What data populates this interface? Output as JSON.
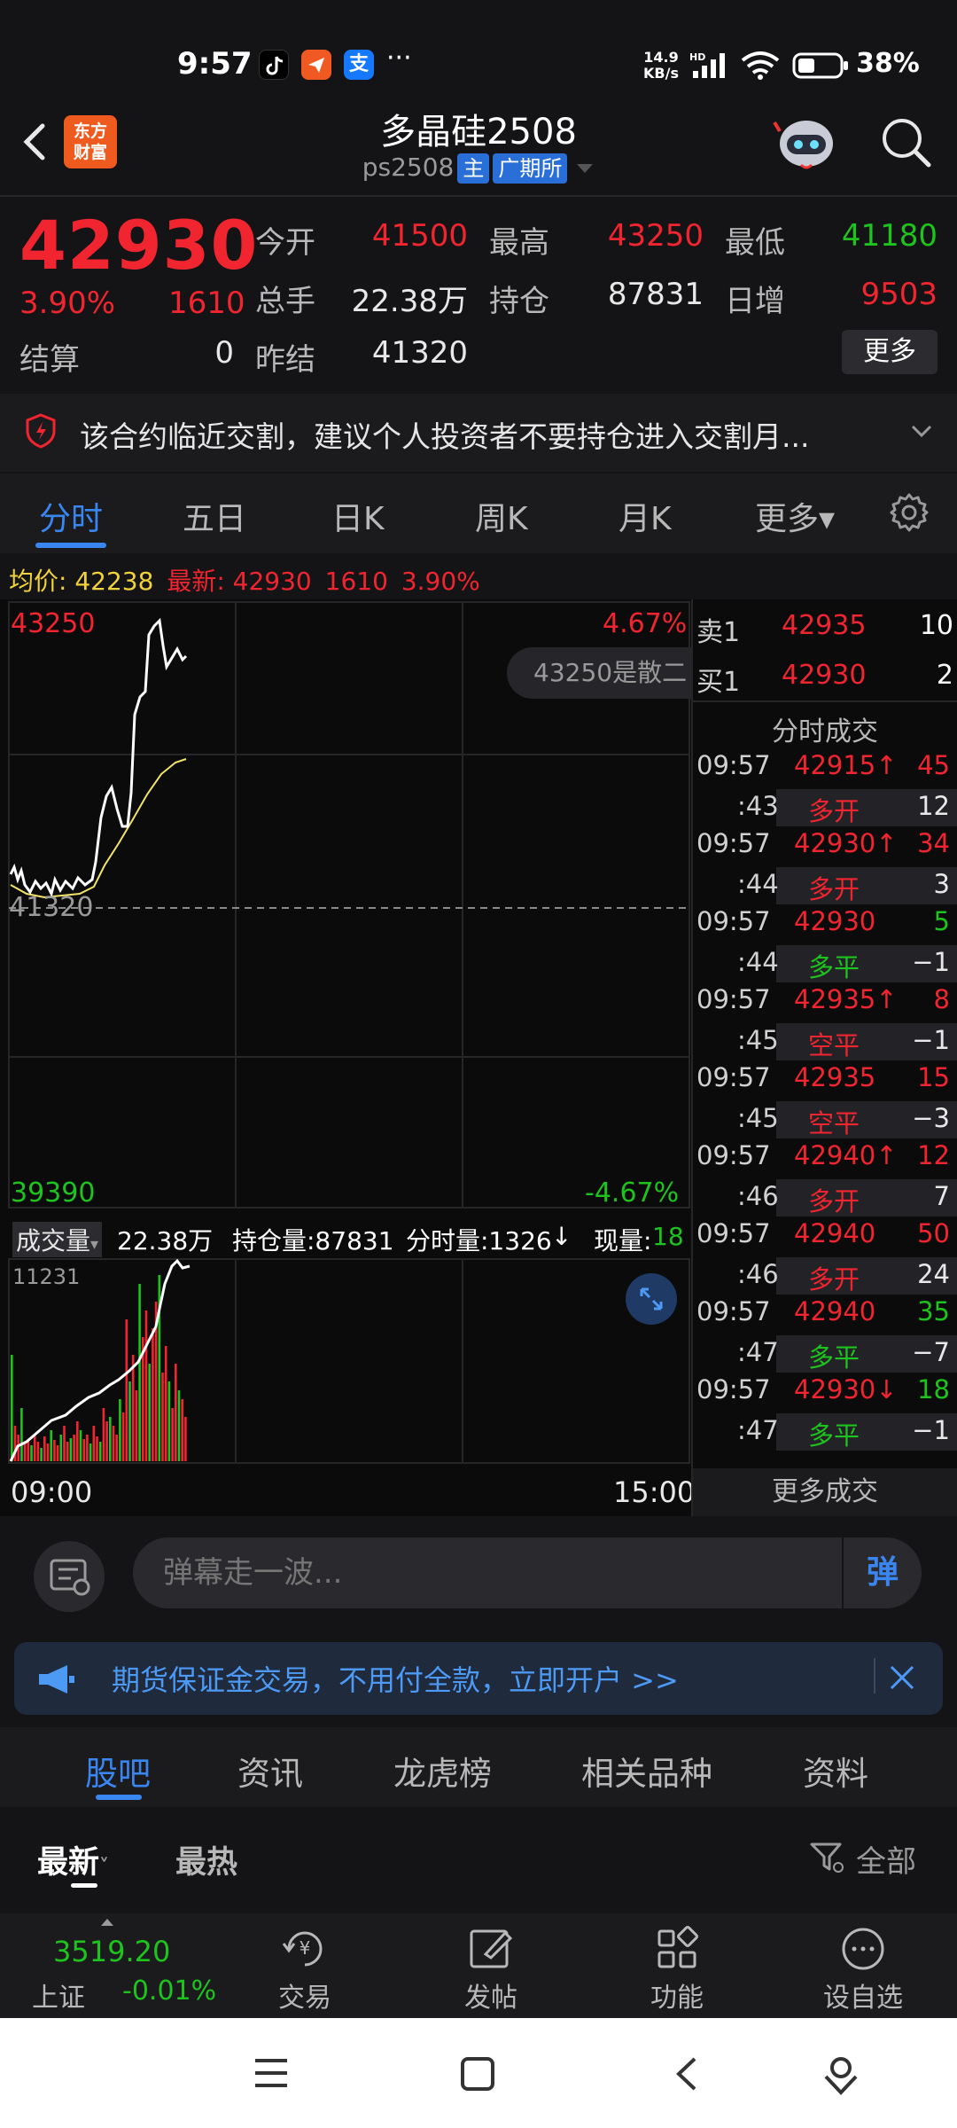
{
  "status_bar": {
    "time": "9:57",
    "netspeed_value": "14.9",
    "netspeed_unit": "KB/s",
    "battery": "38%",
    "apps": [
      "tiktok-icon",
      "messenger-icon",
      "alipay-icon"
    ],
    "alipay_glyph": "支",
    "more": "···"
  },
  "header": {
    "logo_line1": "东方",
    "logo_line2": "财富",
    "title": "多晶硅2508",
    "code": "ps2508",
    "tag_main": "主",
    "tag_exchange": "广期所"
  },
  "quote": {
    "price": "42930",
    "pct": "3.90%",
    "change": "1610",
    "open_label": "今开",
    "open": "41500",
    "high_label": "最高",
    "high": "43250",
    "low_label": "最低",
    "low": "41180",
    "vol_label": "总手",
    "vol": "22.38万",
    "oi_label": "持仓",
    "oi": "87831",
    "daily_inc_label": "日增",
    "daily_inc": "9503",
    "settle_label": "结算",
    "settle": "0",
    "prev_settle_label": "昨结",
    "prev_settle": "41320",
    "more_button": "更多"
  },
  "notice": {
    "text": "该合约临近交割，建议个人投资者不要持仓进入交割月..."
  },
  "chart_tabs": [
    {
      "label": "分时",
      "active": true
    },
    {
      "label": "五日",
      "active": false
    },
    {
      "label": "日K",
      "active": false
    },
    {
      "label": "周K",
      "active": false
    },
    {
      "label": "月K",
      "active": false
    },
    {
      "label": "更多▾",
      "active": false
    }
  ],
  "info_line": {
    "avg_label": "均价:",
    "avg": "42238",
    "latest_label": "最新:",
    "latest": "42930",
    "change": "1610",
    "pct": "3.90%"
  },
  "chart": {
    "y_top": "43250",
    "y_mid": "41320",
    "y_bottom": "39390",
    "pct_top": "4.67%",
    "pct_bottom": "-4.67%",
    "tooltip": "43250是散二",
    "vol_bar_label": "成交量",
    "vol_total": "22.38万",
    "oi_text": "持仓量:87831",
    "tick_vol_text": "分时量:1326",
    "tick_arrow": "↓",
    "cur_vol_label": "现量:",
    "cur_vol": "18",
    "vol_axis_top": "11231",
    "time_start": "09:00",
    "time_end": "15:00",
    "colors": {
      "up": "#f0252f",
      "down": "#1ec31e",
      "price_line": "#ffffff",
      "avg_line": "#f2e36a"
    }
  },
  "chart_data": {
    "type": "line",
    "series": [],
    "ylim": [
      39390,
      43250
    ],
    "x": [
      "09:00",
      "15:00"
    ]
  },
  "order_book": {
    "ask_label": "卖1",
    "ask_price": "42935",
    "ask_vol": "10",
    "bid_label": "买1",
    "bid_price": "42930",
    "bid_vol": "2",
    "trades_title": "分时成交",
    "more_trades": "更多成交",
    "trades": [
      {
        "time": "09:57",
        "price": "42915↑",
        "vol": "45",
        "sub_time": ":43",
        "type": "多开",
        "type_vol": "12",
        "price_color": "red",
        "vol_color": "red",
        "type_color": "red",
        "type_vol_color": "white"
      },
      {
        "time": "09:57",
        "price": "42930↑",
        "vol": "34",
        "sub_time": ":44",
        "type": "多开",
        "type_vol": "3",
        "price_color": "red",
        "vol_color": "red",
        "type_color": "red",
        "type_vol_color": "white"
      },
      {
        "time": "09:57",
        "price": "42930",
        "vol": "5",
        "sub_time": ":44",
        "type": "多平",
        "type_vol": "−1",
        "price_color": "red",
        "vol_color": "green",
        "type_color": "green",
        "type_vol_color": "white"
      },
      {
        "time": "09:57",
        "price": "42935↑",
        "vol": "8",
        "sub_time": ":45",
        "type": "空平",
        "type_vol": "−1",
        "price_color": "red",
        "vol_color": "red",
        "type_color": "red",
        "type_vol_color": "white"
      },
      {
        "time": "09:57",
        "price": "42935",
        "vol": "15",
        "sub_time": ":45",
        "type": "空平",
        "type_vol": "−3",
        "price_color": "red",
        "vol_color": "red",
        "type_color": "red",
        "type_vol_color": "white"
      },
      {
        "time": "09:57",
        "price": "42940↑",
        "vol": "12",
        "sub_time": ":46",
        "type": "多开",
        "type_vol": "7",
        "price_color": "red",
        "vol_color": "red",
        "type_color": "red",
        "type_vol_color": "white"
      },
      {
        "time": "09:57",
        "price": "42940",
        "vol": "50",
        "sub_time": ":46",
        "type": "多开",
        "type_vol": "24",
        "price_color": "red",
        "vol_color": "red",
        "type_color": "red",
        "type_vol_color": "white"
      },
      {
        "time": "09:57",
        "price": "42940",
        "vol": "35",
        "sub_time": ":47",
        "type": "多平",
        "type_vol": "−7",
        "price_color": "red",
        "vol_color": "green",
        "type_color": "green",
        "type_vol_color": "white"
      },
      {
        "time": "09:57",
        "price": "42930↓",
        "vol": "18",
        "sub_time": ":47",
        "type": "多平",
        "type_vol": "−1",
        "price_color": "red",
        "vol_color": "green",
        "type_color": "green",
        "type_vol_color": "white"
      }
    ]
  },
  "danmaku": {
    "placeholder": "弹幕走一波...",
    "send": "弹"
  },
  "ad": {
    "text": "期货保证金交易，不用付全款，立即开户 >>"
  },
  "section_tabs": [
    {
      "label": "股吧",
      "active": true
    },
    {
      "label": "资讯",
      "active": false
    },
    {
      "label": "龙虎榜",
      "active": false
    },
    {
      "label": "相关品种",
      "active": false
    },
    {
      "label": "资料",
      "active": false
    }
  ],
  "sort": {
    "latest": "最新",
    "hot": "最热",
    "filter": "全部"
  },
  "bottom_nav": {
    "index_value": "3519.20",
    "index_name": "上证",
    "index_change": "-0.01%",
    "items": [
      {
        "label": "交易",
        "icon": "trade-icon"
      },
      {
        "label": "发帖",
        "icon": "post-icon"
      },
      {
        "label": "功能",
        "icon": "apps-icon"
      },
      {
        "label": "设自选",
        "icon": "watchlist-icon"
      }
    ]
  }
}
